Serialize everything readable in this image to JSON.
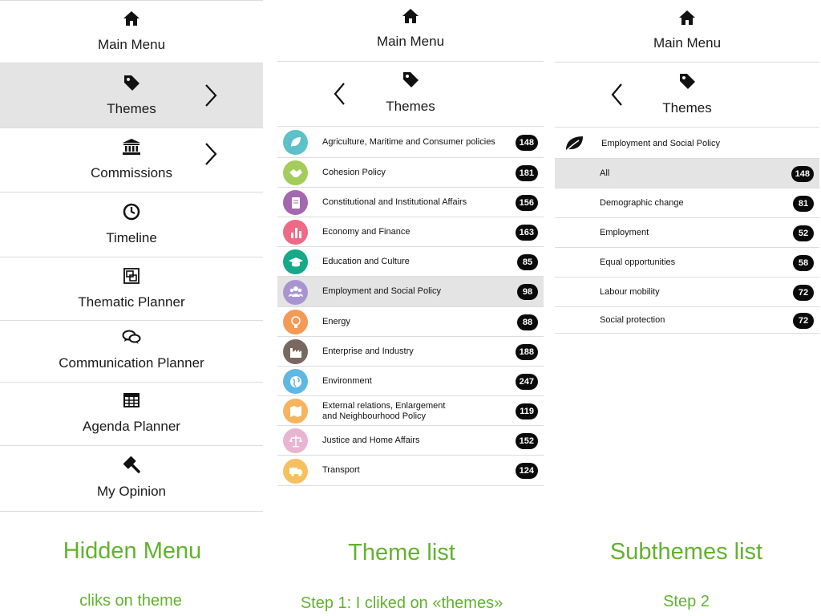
{
  "hidden_menu": {
    "items": [
      {
        "label": "Main Menu",
        "icon": "home-icon"
      },
      {
        "label": "Themes",
        "icon": "tag-icon",
        "active": true,
        "chevron": true
      },
      {
        "label": "Commissions",
        "icon": "bank-icon",
        "chevron": true
      },
      {
        "label": "Timeline",
        "icon": "clock-icon"
      },
      {
        "label": "Thematic Planner",
        "icon": "overlap-squares-icon"
      },
      {
        "label": "Communication Planner",
        "icon": "chat-bubbles-icon"
      },
      {
        "label": "Agenda Planner",
        "icon": "table-icon"
      },
      {
        "label": "My Opinion",
        "icon": "gavel-icon"
      }
    ]
  },
  "theme_list": {
    "main_menu_label": "Main Menu",
    "title": "Themes",
    "items": [
      {
        "label": "Agriculture, Maritime and Consumer policies",
        "count": "148",
        "color": "#5cc1c9",
        "icon": "leaf-icon"
      },
      {
        "label": "Cohesion Policy",
        "count": "181",
        "color": "#a4cc5a",
        "icon": "handshake-icon"
      },
      {
        "label": "Constitutional and Institutional Affairs",
        "count": "156",
        "color": "#a468b0",
        "icon": "book-icon"
      },
      {
        "label": "Economy and Finance",
        "count": "163",
        "color": "#ef6a84",
        "icon": "bar-chart-icon"
      },
      {
        "label": "Education and Culture",
        "count": "85",
        "color": "#15a889",
        "icon": "graduation-cap-icon"
      },
      {
        "label": "Employment and Social Policy",
        "count": "98",
        "color": "#a895d0",
        "icon": "people-icon",
        "selected": true
      },
      {
        "label": "Energy",
        "count": "88",
        "color": "#f39a57",
        "icon": "lightbulb-icon"
      },
      {
        "label": "Enterprise and Industry",
        "count": "188",
        "color": "#786860",
        "icon": "factory-icon"
      },
      {
        "label": "Environment",
        "count": "247",
        "color": "#5fb8e4",
        "icon": "globe-icon"
      },
      {
        "label": "External relations, Enlargement and Neighbourhood Policy",
        "label_line1": "External relations, Enlargement",
        "label_line2": "and Neighbourhood Policy",
        "count": "119",
        "color": "#f6b45e",
        "icon": "map-icon"
      },
      {
        "label": "Justice and Home Affairs",
        "count": "152",
        "color": "#e9b4d2",
        "icon": "scales-icon"
      },
      {
        "label": "Transport",
        "count": "124",
        "color": "#f6c061",
        "icon": "truck-icon"
      }
    ]
  },
  "subthemes_list": {
    "main_menu_label": "Main Menu",
    "title": "Themes",
    "theme": {
      "label": "Employment and Social Policy",
      "icon": "leaf-icon"
    },
    "items": [
      {
        "label": "All",
        "count": "148",
        "selected": true
      },
      {
        "label": "Demographic change",
        "count": "81"
      },
      {
        "label": "Employment",
        "count": "52"
      },
      {
        "label": "Equal opportunities",
        "count": "58"
      },
      {
        "label": "Labour mobility",
        "count": "72"
      },
      {
        "label": "Social protection",
        "count": "72"
      }
    ]
  },
  "captions": {
    "panel1_title": "Hidden Menu",
    "panel1_sub": "cliks on theme",
    "panel2_title": "Theme list",
    "panel2_sub": "Step 1: I cliked on «themes»",
    "panel3_title": "Subthemes list",
    "panel3_sub": "Step 2"
  },
  "colors": {
    "accent_green": "#62b22f",
    "selected_row": "#e4e4e4",
    "badge": "#0a0a0a"
  }
}
